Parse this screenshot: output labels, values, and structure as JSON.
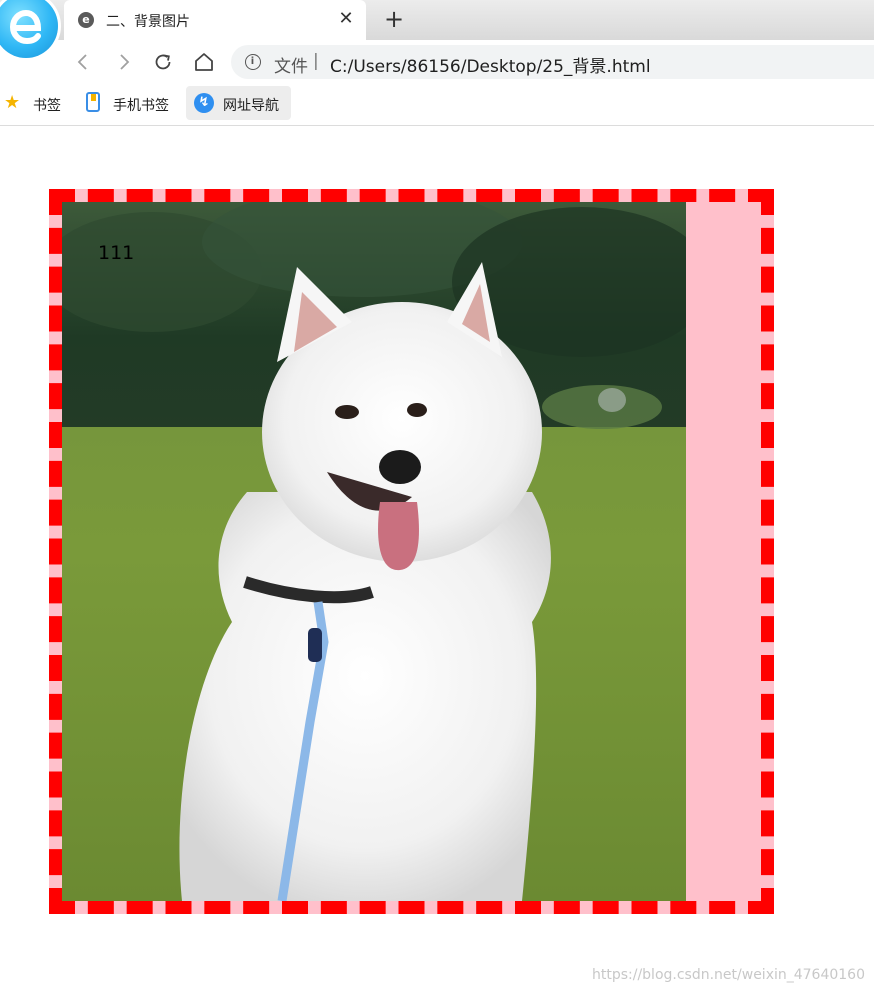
{
  "browser": {
    "tab": {
      "title": "二、背景图片",
      "favicon": "e-browser-icon"
    },
    "new_tab_label": "+",
    "close_label": "✕"
  },
  "toolbar": {
    "scheme_label": "文件",
    "separator": "|",
    "url": "C:/Users/86156/Desktop/25_背景.html"
  },
  "bookmarks": [
    {
      "label": "书签",
      "icon": "star-icon"
    },
    {
      "label": "手机书签",
      "icon": "mobile-bookmark-icon"
    },
    {
      "label": "网址导航",
      "icon": "navigation-icon"
    }
  ],
  "page": {
    "box_text": "111",
    "box_background": "#ffc0cb",
    "box_border_color": "#ff0000",
    "image_subject": "samoyed-dog-photo"
  },
  "watermark": "https://blog.csdn.net/weixin_47640160"
}
